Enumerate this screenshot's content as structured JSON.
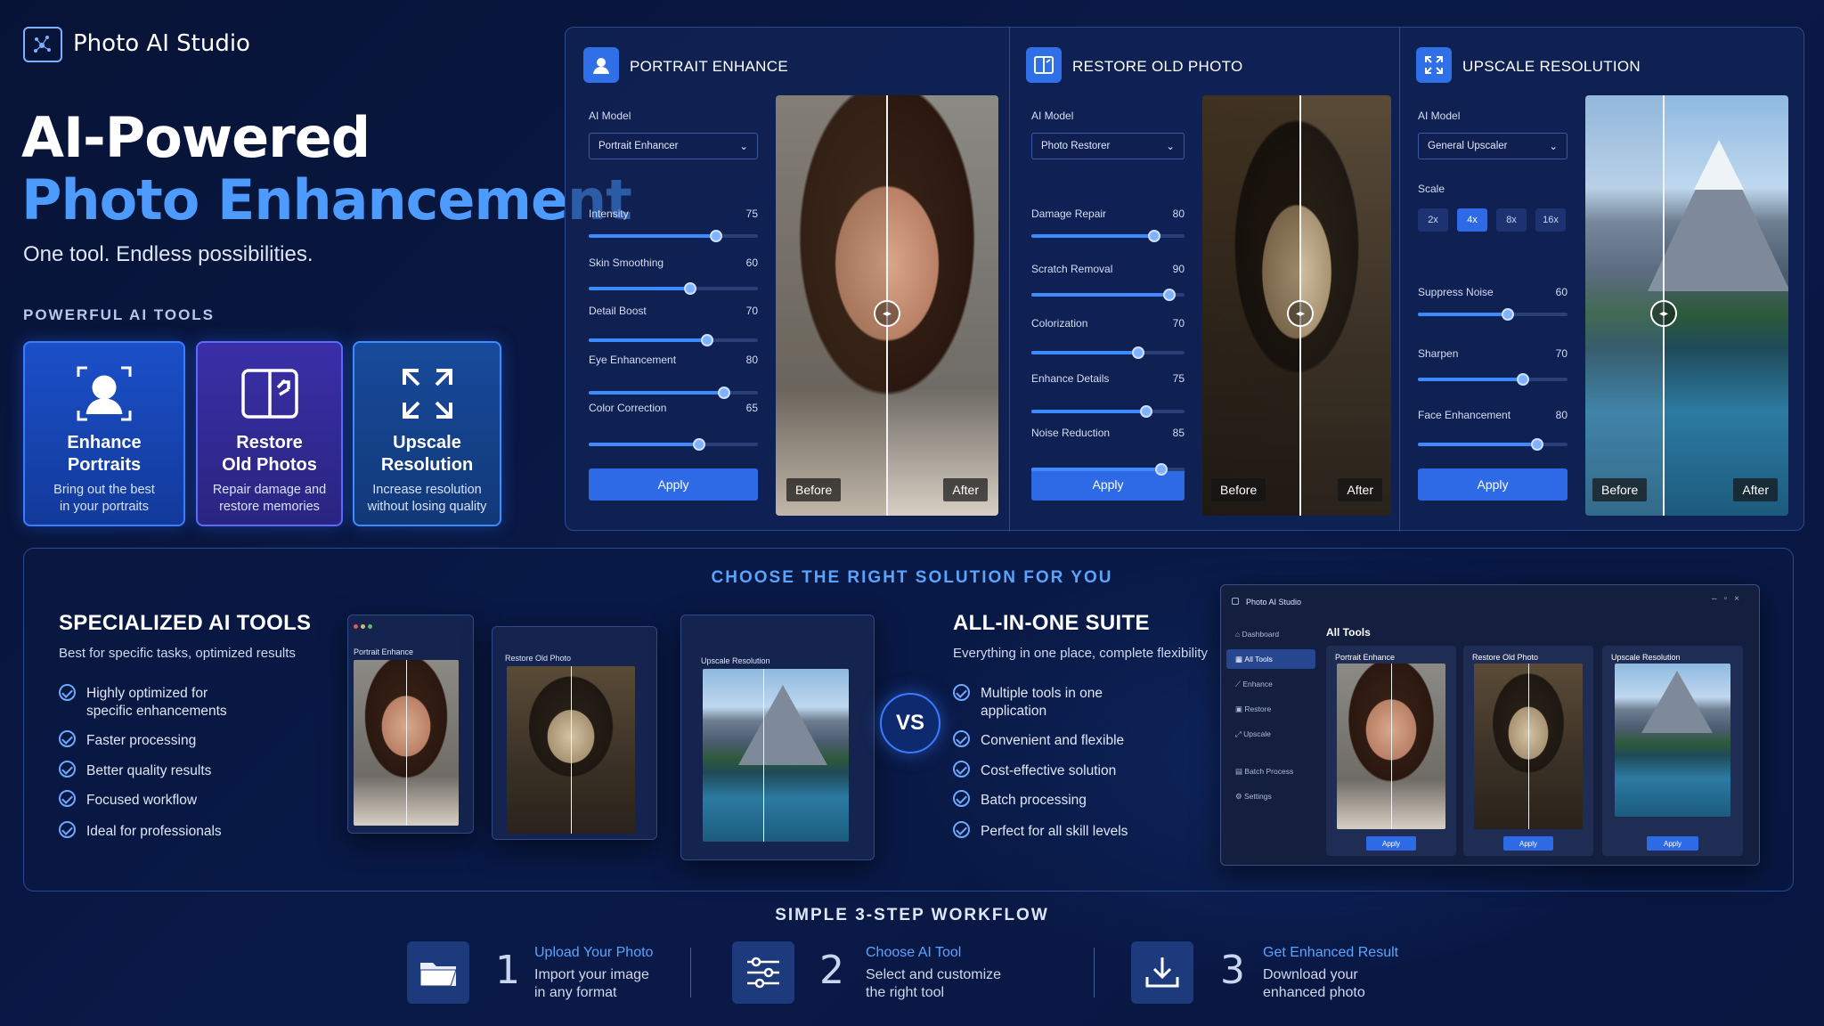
{
  "app": {
    "title": "Photo AI Studio"
  },
  "hero": {
    "line1": "AI-Powered",
    "line2": "Photo Enhancement",
    "tagline": "One tool. Endless possibilities."
  },
  "tools_section": {
    "label": "POWERFUL AI TOOLS",
    "cards": [
      {
        "title1": "Enhance",
        "title2": "Portraits",
        "desc1": "Bring out the best",
        "desc2": "in your portraits",
        "icon": "portrait-icon"
      },
      {
        "title1": "Restore",
        "title2": "Old Photos",
        "desc1": "Repair damage and",
        "desc2": "restore memories",
        "icon": "restore-icon"
      },
      {
        "title1": "Upscale",
        "title2": "Resolution",
        "desc1": "Increase resolution",
        "desc2": "without losing quality",
        "icon": "upscale-icon"
      }
    ]
  },
  "panels": [
    {
      "title": "PORTRAIT ENHANCE",
      "model_label": "AI Model",
      "model_value": "Portrait Enhancer",
      "sliders": [
        {
          "label": "Intensity",
          "value": 75
        },
        {
          "label": "Skin Smoothing",
          "value": 60
        },
        {
          "label": "Detail Boost",
          "value": 70
        },
        {
          "label": "Eye Enhancement",
          "value": 80
        },
        {
          "label": "Color Correction",
          "value": 65
        }
      ],
      "apply": "Apply",
      "before": "Before",
      "after": "After"
    },
    {
      "title": "RESTORE OLD PHOTO",
      "model_label": "AI Model",
      "model_value": "Photo Restorer",
      "sliders": [
        {
          "label": "Damage Repair",
          "value": 80
        },
        {
          "label": "Scratch Removal",
          "value": 90
        },
        {
          "label": "Colorization",
          "value": 70
        },
        {
          "label": "Enhance Details",
          "value": 75
        },
        {
          "label": "Noise Reduction",
          "value": 85
        }
      ],
      "apply": "Apply",
      "before": "Before",
      "after": "After"
    },
    {
      "title": "UPSCALE RESOLUTION",
      "model_label": "AI Model",
      "model_value": "General Upscaler",
      "scale_label": "Scale",
      "scales": [
        "2x",
        "4x",
        "8x",
        "16x"
      ],
      "scale_selected": "4x",
      "sliders": [
        {
          "label": "Suppress Noise",
          "value": 60
        },
        {
          "label": "Sharpen",
          "value": 70
        },
        {
          "label": "Face Enhancement",
          "value": 80
        }
      ],
      "apply": "Apply",
      "before": "Before",
      "after": "After"
    }
  ],
  "compare": {
    "heading": "CHOOSE THE RIGHT SOLUTION FOR YOU",
    "left": {
      "title": "SPECIALIZED AI TOOLS",
      "subtitle": "Best for specific tasks, optimized results",
      "items": [
        "Highly optimized for",
        "specific enhancements",
        "Faster processing",
        "Better quality results",
        "Focused workflow",
        "Ideal for professionals"
      ]
    },
    "windows": [
      "Portrait Enhance",
      "Restore Old Photo",
      "Upscale Resolution"
    ],
    "vs": "VS",
    "right": {
      "title": "ALL-IN-ONE SUITE",
      "subtitle": "Everything in one place, complete flexibility",
      "items": [
        "Multiple tools in one",
        "application",
        "Convenient and flexible",
        "Cost-effective solution",
        "Batch processing",
        "Perfect for all skill levels"
      ]
    },
    "suite": {
      "title": "Photo AI Studio",
      "nav": [
        "Dashboard",
        "All Tools",
        "Enhance",
        "Restore",
        "Upscale",
        "Batch Process",
        "Settings"
      ],
      "heading": "All Tools",
      "cards": [
        "Portrait Enhance",
        "Restore Old Photo",
        "Upscale Resolution"
      ],
      "apply": "Apply"
    }
  },
  "workflow": {
    "title": "SIMPLE 3-STEP WORKFLOW",
    "steps": [
      {
        "num": "1",
        "title": "Upload Your Photo",
        "line1": "Import your image",
        "line2": "in any format"
      },
      {
        "num": "2",
        "title": "Choose AI Tool",
        "line1": "Select and customize",
        "line2": "the right tool"
      },
      {
        "num": "3",
        "title": "Get Enhanced Result",
        "line1": "Download your",
        "line2": "enhanced photo"
      }
    ]
  },
  "colors": {
    "accent": "#3d8bff",
    "heading_blue": "#4d9bff",
    "bg": "#0a1a47"
  }
}
